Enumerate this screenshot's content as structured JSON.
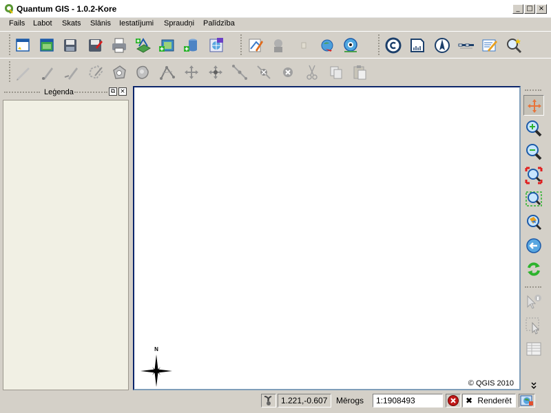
{
  "window": {
    "title": "Quantum GIS - 1.0.2-Kore",
    "controls": {
      "minimize": "_",
      "maximize": "□",
      "close": "×"
    }
  },
  "menu": [
    "Fails",
    "Labot",
    "Skats",
    "Slānis",
    "Iestatījumi",
    "Spraudņi",
    "Palīdzība"
  ],
  "toolbars": {
    "file": [
      "new-project-icon",
      "open-project-icon",
      "save-icon",
      "save-as-icon",
      "print-icon",
      "add-vector-layer-icon",
      "add-raster-layer-icon",
      "add-postgis-layer-icon",
      "add-wms-layer-icon"
    ],
    "layers": [
      "new-vector-layer-icon",
      "overview-icon",
      "grass-icon",
      "gps-icon",
      "georeferencer-icon"
    ],
    "decorations": [
      "copyright-icon",
      "grid-icon",
      "north-arrow-icon",
      "scale-bar-icon",
      "edit-icon",
      "search-icon"
    ],
    "digitizing": [
      "toggle-editing-icon",
      "capture-point-icon",
      "capture-line-icon",
      "capture-polygon-icon",
      "add-ring-icon",
      "add-island-icon",
      "split-features-icon",
      "move-feature-icon",
      "move-vertex-icon",
      "add-vertex-icon",
      "delete-vertex-icon",
      "delete-selected-icon",
      "cut-icon",
      "copy-icon",
      "paste-icon"
    ]
  },
  "legend": {
    "title": "Leģenda",
    "float_button": "⧉",
    "close_button": "×"
  },
  "map": {
    "north_label": "N",
    "copyright": "© QGIS 2010"
  },
  "nav_toolbar": [
    "pan-icon",
    "zoom-in-icon",
    "zoom-out-icon",
    "zoom-full-icon",
    "zoom-selection-icon",
    "zoom-layer-icon",
    "zoom-last-icon",
    "refresh-icon",
    "identify-icon",
    "select-icon",
    "attribute-table-icon"
  ],
  "status": {
    "coordinates": "1.221,-0.607",
    "scale_label": "Mērogs",
    "scale_value": "1:1908493",
    "render_label": "Renderēt",
    "stop_icon": "stop-render-icon",
    "projection_icon": "projection-icon"
  },
  "colors": {
    "accent": "#0a246a",
    "legend_bg": "#f1f0e4",
    "chrome": "#d4d0c8"
  }
}
